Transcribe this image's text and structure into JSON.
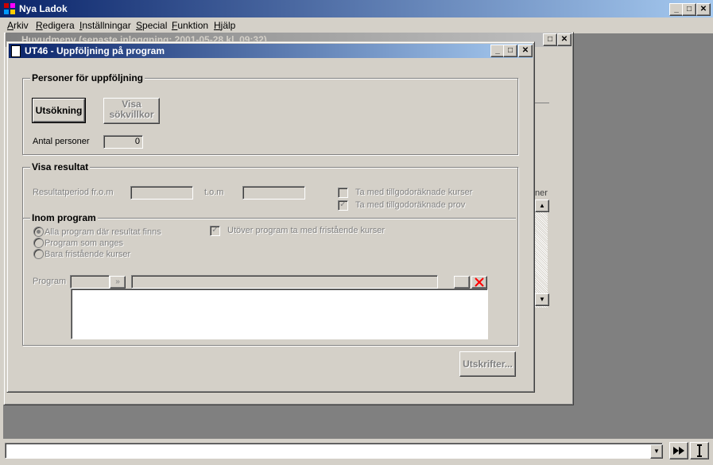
{
  "app": {
    "title": "Nya Ladok"
  },
  "menu": [
    "Arkiv",
    "Redigera",
    "Inställningar",
    "Special",
    "Funktion",
    "Hjälp"
  ],
  "window_controls": {
    "minimize": "_",
    "maximize": "□",
    "close": "✕"
  },
  "back_window": {
    "title": "Huvudmeny   (senaste inloggning: 2001-05-28 kl. 09:32)",
    "partial_label": "ner"
  },
  "dialog": {
    "title": "UT46 - Uppföljning på program",
    "personer": {
      "group_label": "Personer för uppföljning",
      "search_button": "Utsökning",
      "show_criteria_button": [
        "Visa",
        "sökvillkor"
      ],
      "count_label": "Antal personer",
      "count_value": "0"
    },
    "resultat": {
      "group_label": "Visa resultat",
      "period_label": "Resultatperiod fr.o.m",
      "tom_label": "t.o.m",
      "include_credited_courses": "Ta med tillgodoräknade kurser",
      "include_credited_exams": "Ta med tillgodoräknade prov",
      "include_credited_courses_checked": false,
      "include_credited_exams_checked": true
    },
    "inom_program": {
      "group_label": "Inom program",
      "options": [
        "Alla program där resultat finns",
        "Program som anges",
        "Bara fristående kurser"
      ],
      "selected_index": 0,
      "beyond_program_label": "Utöver program ta med fristående kurser",
      "beyond_program_checked": true,
      "program_label": "Program",
      "dropdown_glyph": "»"
    },
    "print_button": "Utskrifter..."
  },
  "colors": {
    "title_active": "#0a246a",
    "title_inactive": "#808080",
    "face": "#d4d0c8",
    "clear_red": "#ff0000"
  }
}
